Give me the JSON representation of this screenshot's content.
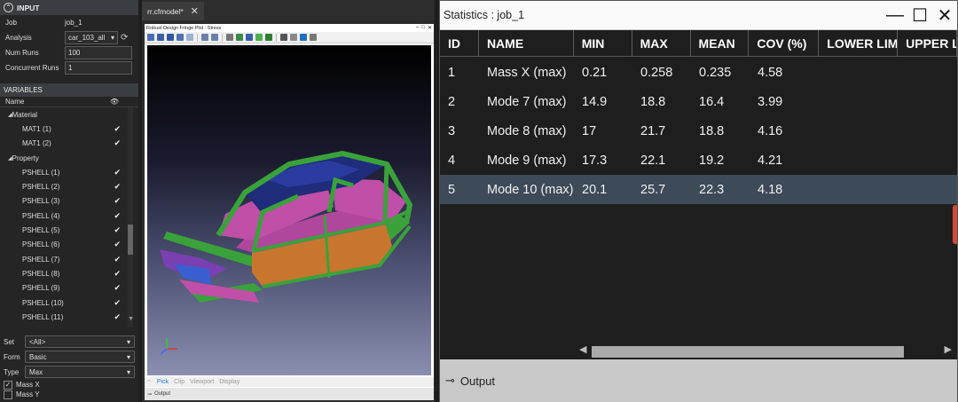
{
  "input": {
    "header": "INPUT",
    "job_label": "Job",
    "job_value": "job_1",
    "analysis_label": "Analysis",
    "analysis_value": "car_103_all",
    "num_runs_label": "Num Runs",
    "num_runs_value": "100",
    "concurrent_label": "Concurrent Runs",
    "concurrent_value": "1"
  },
  "variables": {
    "header": "VARIABLES",
    "name_col": "Name",
    "groups": [
      {
        "label": "Material",
        "items": [
          "MAT1 (1)",
          "MAT1 (2)"
        ]
      },
      {
        "label": "Property",
        "items": [
          "PSHELL (1)",
          "PSHELL (2)",
          "PSHELL (3)",
          "PSHELL (4)",
          "PSHELL (5)",
          "PSHELL (6)",
          "PSHELL (7)",
          "PSHELL (8)",
          "PSHELL (9)",
          "PSHELL (10)",
          "PSHELL (11)"
        ]
      }
    ]
  },
  "filters": {
    "set_label": "Set",
    "set_value": "<All>",
    "form_label": "Form",
    "form_value": "Basic",
    "type_label": "Type",
    "type_value": "Max",
    "checks": [
      "Mass X",
      "Mass Y"
    ]
  },
  "viewer": {
    "tab_label": "rr.cfmodel*",
    "plot_title": "Robust Design Fringe Plot : Stress",
    "footer_items": [
      "Pick",
      "Clip",
      "Viewport",
      "Display"
    ],
    "output_label": "Output"
  },
  "stats": {
    "title": "Statistics : job_1",
    "columns": [
      "ID",
      "NAME",
      "MIN",
      "MAX",
      "MEAN",
      "COV (%)",
      "LOWER LIMIT",
      "UPPER LIMIT"
    ],
    "rows": [
      [
        "1",
        "Mass X (max)",
        "0.21",
        "0.258",
        "0.235",
        "4.58"
      ],
      [
        "2",
        "Mode 7 (max)",
        "14.9",
        "18.8",
        "16.4",
        "3.99"
      ],
      [
        "3",
        "Mode 8 (max)",
        "17",
        "21.7",
        "18.8",
        "4.16"
      ],
      [
        "4",
        "Mode 9 (max)",
        "17.3",
        "22.1",
        "19.2",
        "4.21"
      ],
      [
        "5",
        "Mode 10 (max)",
        "20.1",
        "25.7",
        "22.3",
        "4.18"
      ]
    ],
    "selected_row": 5,
    "output_label": "Output"
  },
  "colors": {
    "selected_row": "#3d4a58",
    "accent": "#1e7fd8"
  }
}
